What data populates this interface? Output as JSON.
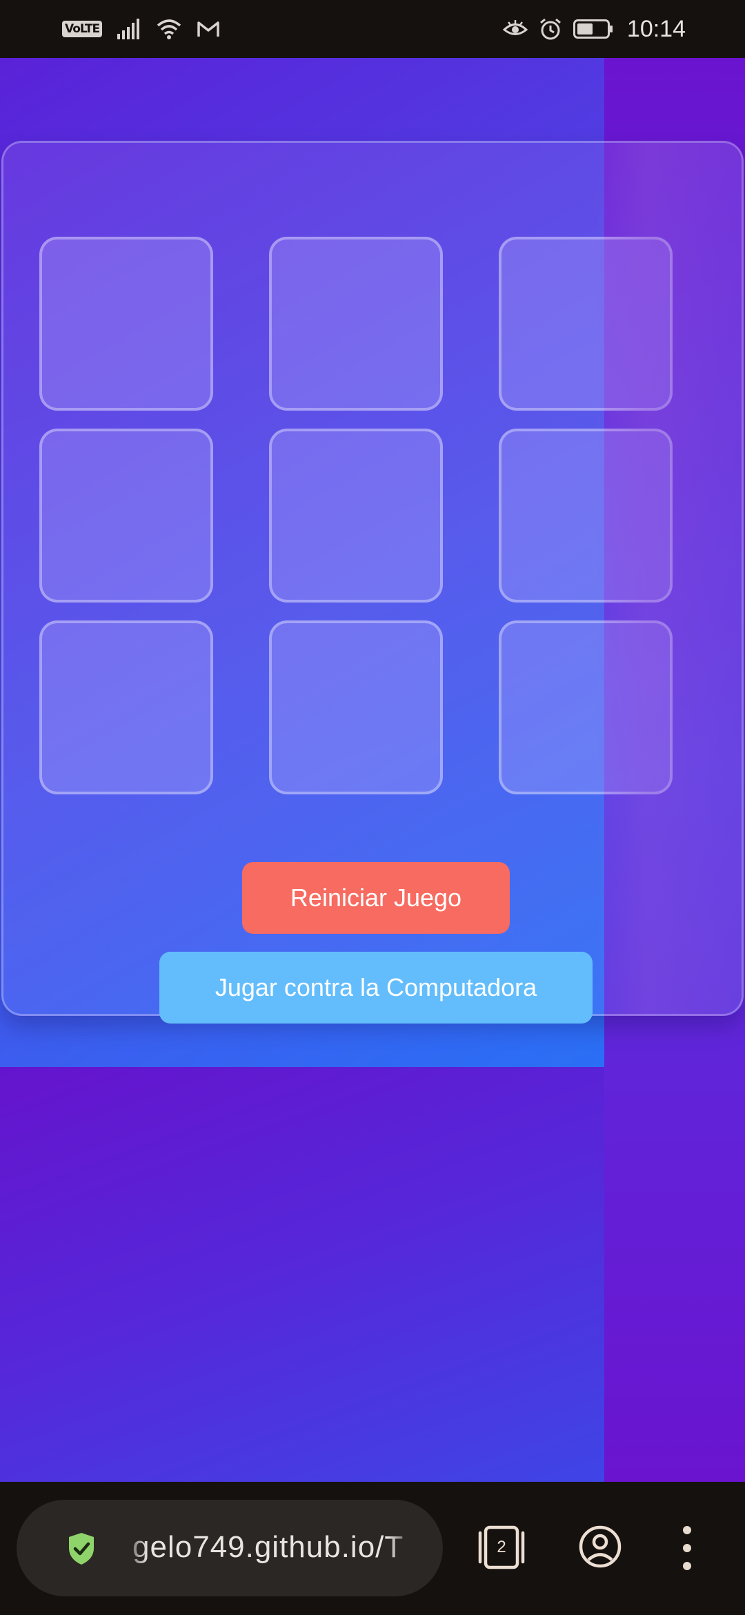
{
  "status_bar": {
    "network_badge": "VoLTE",
    "time": "10:14",
    "icons": [
      "volte-icon",
      "signal-icon",
      "wifi-icon",
      "gmail-icon",
      "eye-comfort-icon",
      "alarm-icon",
      "battery-icon"
    ],
    "battery_level": 0.5
  },
  "game": {
    "board": [
      "",
      "",
      "",
      "",
      "",
      "",
      "",
      "",
      ""
    ],
    "buttons": {
      "reset_label": "Reiniciar Juego",
      "vs_computer_label": "Jugar contra la Computadora"
    },
    "colors": {
      "reset_button": "#f76b60",
      "vs_computer_button": "#63bdfc",
      "background_purple": "#6a12cc",
      "background_blue": "#2a6ff5"
    }
  },
  "browser": {
    "url_fragment": "gelo749.github.io/T",
    "tab_count": "2",
    "icons": [
      "security-shield-icon",
      "tab-switcher-icon",
      "account-icon",
      "more-menu-icon"
    ],
    "colors": {
      "shield": "#8fd46a"
    }
  }
}
